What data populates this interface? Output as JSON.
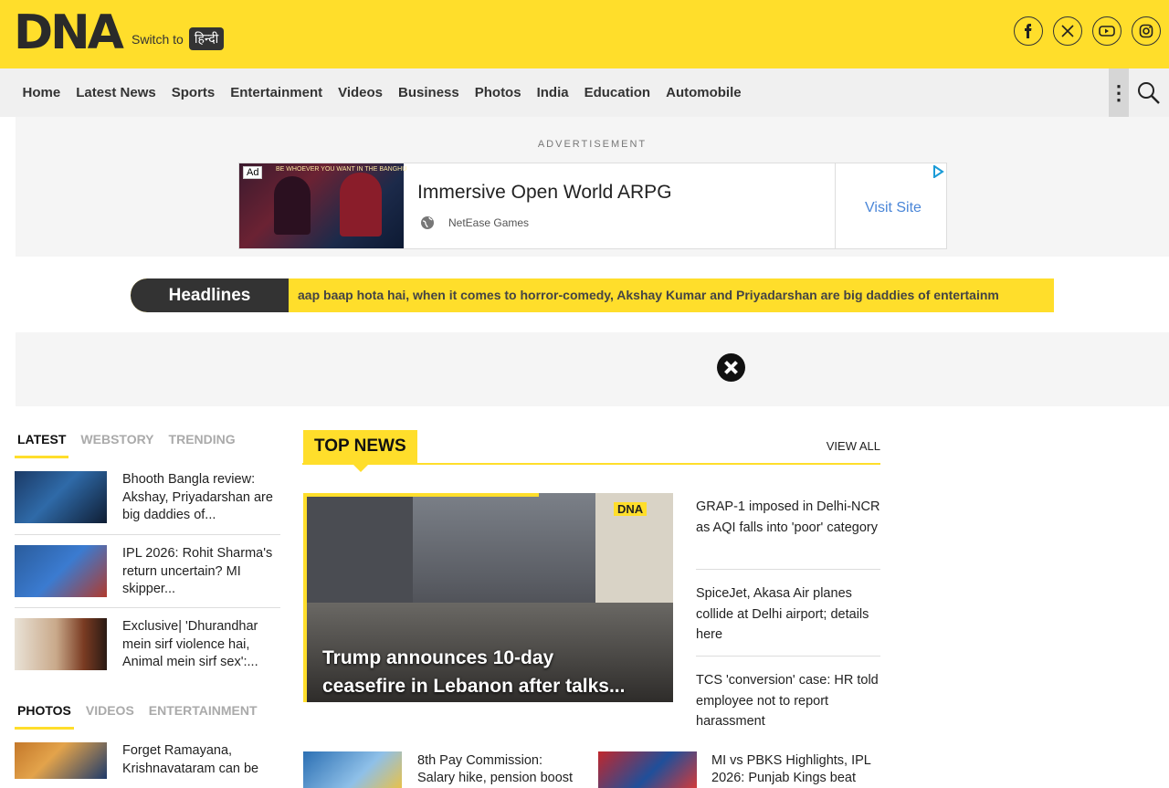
{
  "header": {
    "logo": "DNA",
    "switch_to": "Switch to",
    "switch_lang": "हिन्दी",
    "social": [
      "facebook-icon",
      "x-icon",
      "youtube-icon",
      "instagram-icon"
    ],
    "brand_color": "#ffde2b"
  },
  "nav": {
    "items": [
      "Home",
      "Latest News",
      "Sports",
      "Entertainment",
      "Videos",
      "Business",
      "Photos",
      "India",
      "Education",
      "Automobile"
    ],
    "more": "⋮"
  },
  "ad": {
    "label": "ADVERTISEMENT",
    "badge": "Ad",
    "image_text": "BE WHOEVER YOU WANT IN THE BANGHU",
    "title": "Immersive Open World ARPG",
    "source": "NetEase Games",
    "cta": "Visit Site"
  },
  "headlines": {
    "label": "Headlines",
    "ticker": "aap baap hota hai, when it comes to horror-comedy, Akshay Kumar and Priyadarshan are big daddies of entertainm"
  },
  "left_tabs_1": [
    "LATEST",
    "WEBSTORY",
    "TRENDING"
  ],
  "latest": [
    {
      "text": "Bhooth Bangla review: Akshay, Priyadarshan are big daddies of..."
    },
    {
      "text": "IPL 2026: Rohit Sharma's return uncertain? MI skipper..."
    },
    {
      "text": "Exclusive| 'Dhurandhar mein sirf violence hai, Animal mein sirf sex':..."
    }
  ],
  "left_tabs_2": [
    "PHOTOS",
    "VIDEOS",
    "ENTERTAINMENT"
  ],
  "photos": [
    {
      "text": "Forget Ramayana, Krishnavataram can be"
    }
  ],
  "top_news": {
    "label": "TOP NEWS",
    "view_all": "VIEW ALL",
    "hero_tag": "DNA",
    "hero_line1": "Trump announces 10-day",
    "hero_line2": "ceasefire in Lebanon after talks...",
    "side": [
      "GRAP-1 imposed in Delhi-NCR as AQI falls into 'poor' category",
      "SpiceJet, Akasa Air planes collide at Delhi airport; details here",
      "TCS 'conversion' case: HR told employee not to report harassment"
    ],
    "bottom": [
      "8th Pay Commission: Salary hike, pension boost",
      "MI vs PBKS Highlights, IPL 2026: Punjab Kings beat"
    ]
  }
}
